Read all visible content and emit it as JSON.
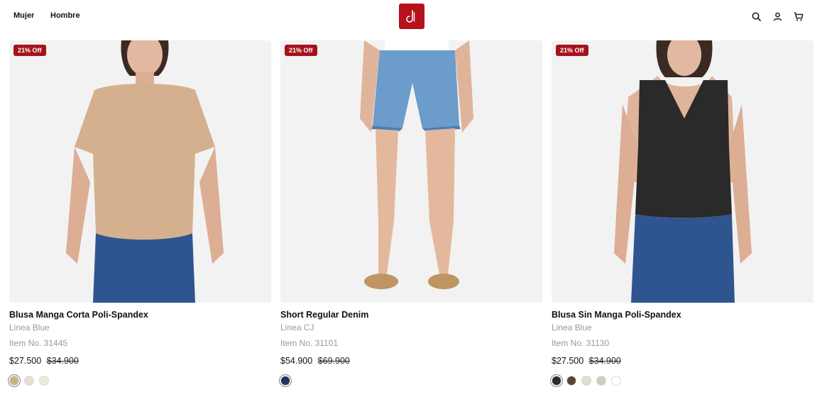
{
  "nav": {
    "items": [
      {
        "label": "Mujer"
      },
      {
        "label": "Hombre"
      }
    ]
  },
  "brand": {
    "accent": "#b5121b"
  },
  "header_icons": [
    "search-icon",
    "user-icon",
    "cart-icon"
  ],
  "products": [
    {
      "badge": "21% Off",
      "title": "Blusa Manga Corta Poli-Spandex",
      "line": "Linea Blue",
      "item_no": "Item No. 31445",
      "price": "$27.500",
      "old_price": "$34.900",
      "swatches": [
        "#cdb37b",
        "#e7e0d2",
        "#efe9dc"
      ],
      "selected_swatch": 0
    },
    {
      "badge": "21% Off",
      "title": "Short Regular Denim",
      "line": "Linea CJ",
      "item_no": "Item No. 31101",
      "price": "$54.900",
      "old_price": "$69.900",
      "swatches": [
        "#1e3366"
      ],
      "selected_swatch": 0
    },
    {
      "badge": "21% Off",
      "title": "Blusa Sin Manga Poli-Spandex",
      "line": "Linea Blue",
      "item_no": "Item No. 31130",
      "price": "$27.500",
      "old_price": "$34.900",
      "swatches": [
        "#2b2b2b",
        "#5a4238",
        "#e4ddd0",
        "#cfcbbd",
        "#ffffff"
      ],
      "selected_swatch": 0
    }
  ]
}
